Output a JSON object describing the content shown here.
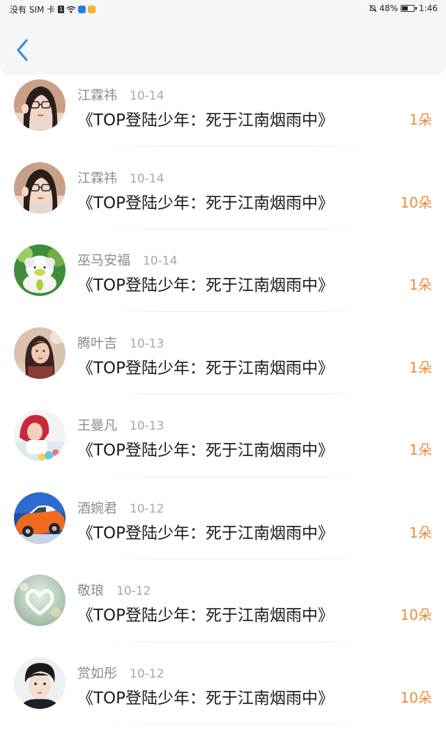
{
  "status_bar": {
    "carrier": "没有 SIM 卡",
    "sim_badge": "1",
    "battery_percent": "48%",
    "battery_level": 0.48,
    "time": "1:46",
    "icons": [
      "sim-icon",
      "wifi-icon",
      "app-notification-blue-icon",
      "app-notification-yellow-icon",
      "bell-muted-icon",
      "battery-icon"
    ]
  },
  "header": {
    "back_icon": "chevron-left-icon",
    "accent_color": "#2a8fe0"
  },
  "colors": {
    "amount": "#ee8a3c",
    "name": "#8c8c8c",
    "title": "#1a1a1a"
  },
  "items": [
    {
      "name": "江霖祎",
      "date": "10-14",
      "title": "《TOP登陆少年：死于江南烟雨中》",
      "amount": "1朵",
      "avatar": "avatar-girl-glasses"
    },
    {
      "name": "江霖祎",
      "date": "10-14",
      "title": "《TOP登陆少年：死于江南烟雨中》",
      "amount": "10朵",
      "avatar": "avatar-girl-glasses"
    },
    {
      "name": "巫马安福",
      "date": "10-14",
      "title": "《TOP登陆少年：死于江南烟雨中》",
      "amount": "1朵",
      "avatar": "avatar-white-toy"
    },
    {
      "name": "腾叶吉",
      "date": "10-13",
      "title": "《TOP登陆少年：死于江南烟雨中》",
      "amount": "1朵",
      "avatar": "avatar-girl-flowers"
    },
    {
      "name": "王曼凡",
      "date": "10-13",
      "title": "《TOP登陆少年：死于江南烟雨中》",
      "amount": "1朵",
      "avatar": "avatar-girl-red"
    },
    {
      "name": "酒婉君",
      "date": "10-12",
      "title": "《TOP登陆少年：死于江南烟雨中》",
      "amount": "1朵",
      "avatar": "avatar-orange-car"
    },
    {
      "name": "敬琅",
      "date": "10-12",
      "title": "《TOP登陆少年：死于江南烟雨中》",
      "amount": "10朵",
      "avatar": "avatar-heart"
    },
    {
      "name": "赏如彤",
      "date": "10-12",
      "title": "《TOP登陆少年：死于江南烟雨中》",
      "amount": "10朵",
      "avatar": "avatar-boy"
    }
  ]
}
